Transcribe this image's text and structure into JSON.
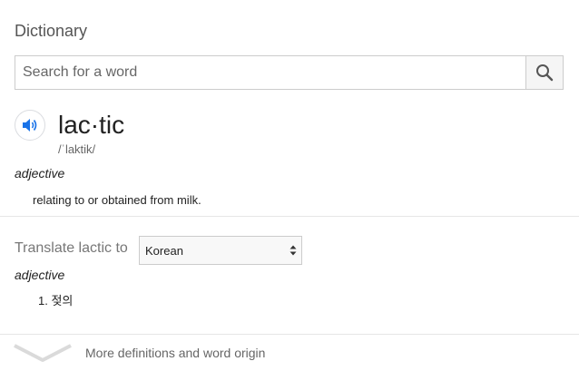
{
  "header": {
    "title": "Dictionary"
  },
  "search": {
    "placeholder": "Search for a word",
    "value": ""
  },
  "entry": {
    "word": "lac·tic",
    "phonetic": "/ˈlaktik/",
    "part_of_speech": "adjective",
    "definition": "relating to or obtained from milk."
  },
  "translate": {
    "label": "Translate lactic to",
    "selected_language": "Korean",
    "part_of_speech": "adjective",
    "items": [
      "1. 젖의"
    ]
  },
  "footer": {
    "more_label": "More definitions and word origin"
  },
  "colors": {
    "accent": "#1a73e8",
    "muted": "#666666"
  },
  "icons": {
    "search": "search-icon",
    "speaker": "speaker-icon",
    "more": "chevron-down-icon",
    "select": "select-arrows-icon"
  }
}
